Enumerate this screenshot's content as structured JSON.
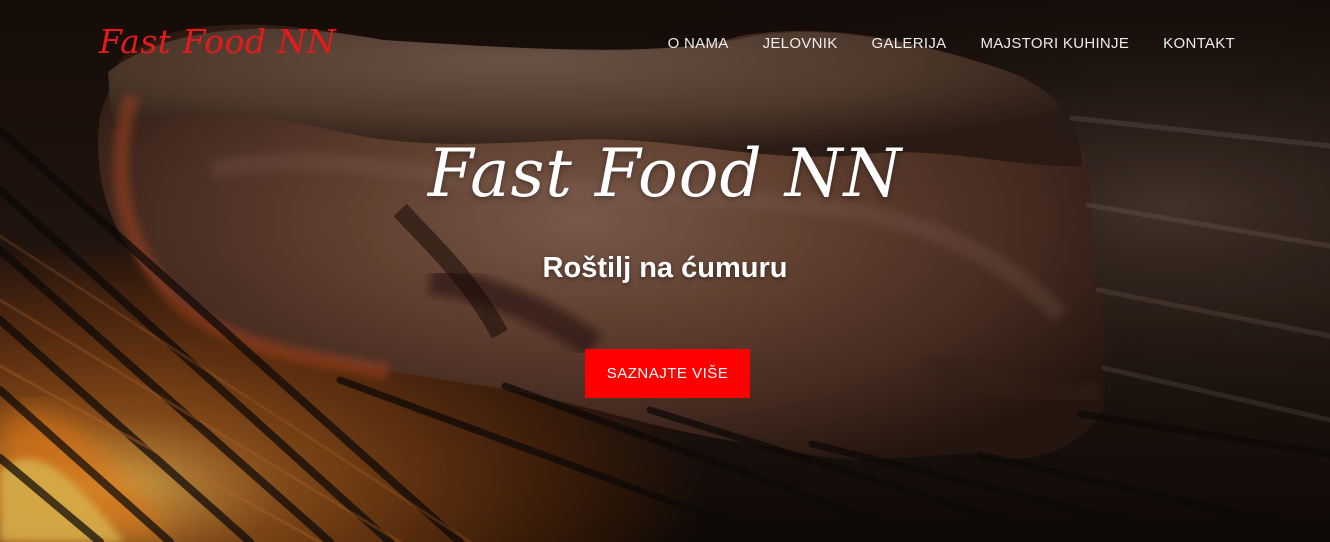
{
  "colors": {
    "brand": "#e41b1b",
    "cta": "#ff0000",
    "text": "#ffffff",
    "nav_text": "#ececec"
  },
  "navbar": {
    "brand": "Fast Food NN",
    "links": [
      {
        "label": "O NAMA"
      },
      {
        "label": "JELOVNIK"
      },
      {
        "label": "GALERIJA"
      },
      {
        "label": "MAJSTORI KUHINJE"
      },
      {
        "label": "KONTAKT"
      }
    ]
  },
  "hero": {
    "title": "Fast Food NN",
    "subtitle": "Roštilj na ćumuru",
    "cta_label": "SAZNAJTE VIŠE",
    "background": "grilled-steak-on-grill-photo"
  }
}
